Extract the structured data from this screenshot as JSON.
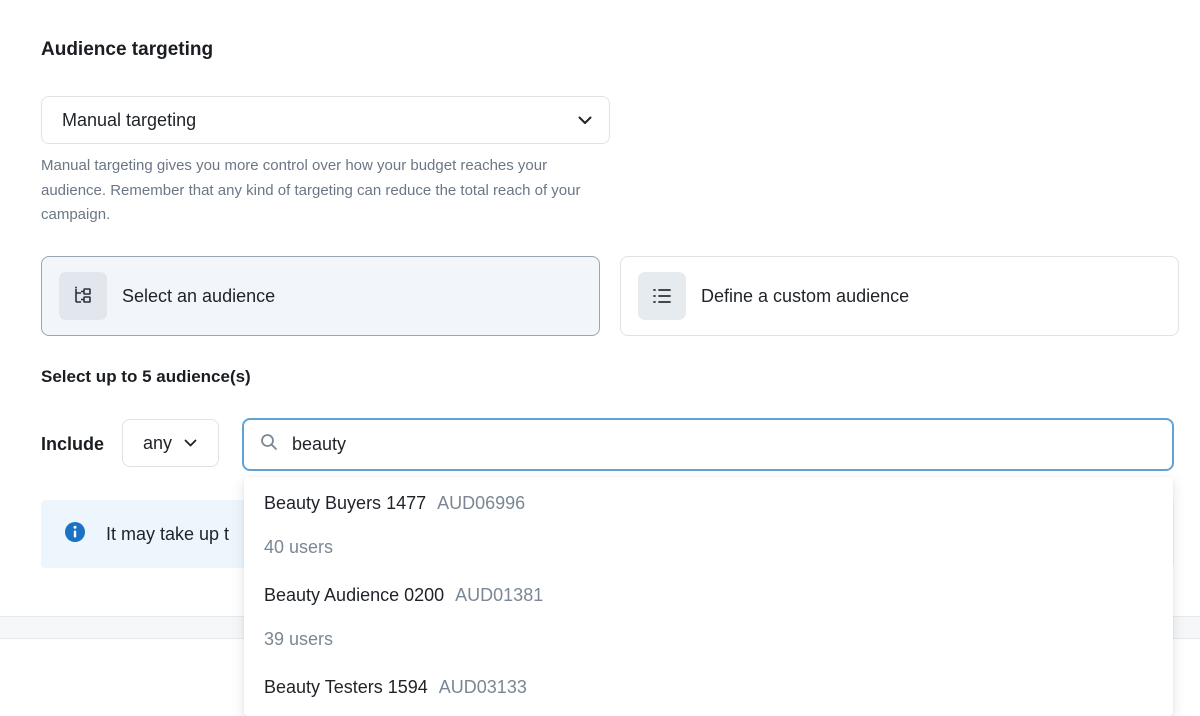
{
  "section_title": "Audience targeting",
  "targeting_select": {
    "value": "Manual targeting"
  },
  "help_text": "Manual targeting gives you more control over how your budget reaches your audience. Remember that any kind of targeting can reduce the total reach of your campaign.",
  "cards": {
    "select_audience": {
      "label": "Select an audience",
      "selected": true,
      "icon": "hierarchy-icon"
    },
    "custom_audience": {
      "label": "Define a custom audience",
      "selected": false,
      "icon": "list-icon"
    }
  },
  "subhead": "Select up to 5 audience(s)",
  "include": {
    "label": "Include",
    "mode": "any"
  },
  "search": {
    "value": "beauty",
    "icon": "search-icon"
  },
  "info": {
    "text": "It may take up t",
    "icon": "info-icon"
  },
  "results": [
    {
      "name": "Beauty Buyers 1477",
      "code": "AUD06996",
      "users": "40 users"
    },
    {
      "name": "Beauty Audience 0200",
      "code": "AUD01381",
      "users": "39 users"
    },
    {
      "name": "Beauty Testers 1594",
      "code": "AUD03133",
      "users": ""
    }
  ],
  "colors": {
    "focus_border": "#5fa3d9",
    "info_bg": "#edf6fc",
    "info_icon": "#1b72c2",
    "muted_text": "#7b8794"
  }
}
